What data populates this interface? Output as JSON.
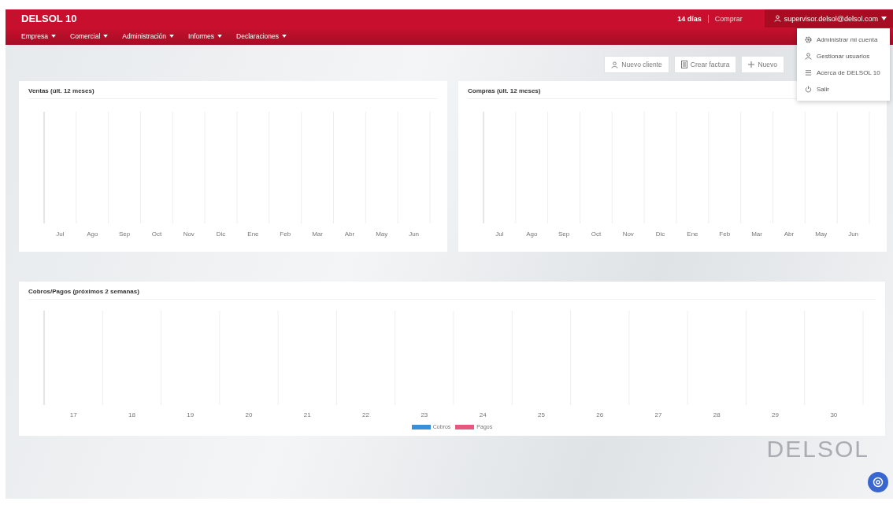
{
  "app": {
    "title": "DELSOL 10",
    "trial": "14 días",
    "trial_link": "Comprar",
    "user": "supervisor.delsol@delsol.com"
  },
  "menu": [
    {
      "label": "Empresa"
    },
    {
      "label": "Comercial"
    },
    {
      "label": "Administración"
    },
    {
      "label": "Informes"
    },
    {
      "label": "Declaraciones"
    }
  ],
  "user_menu": {
    "expanded": true,
    "items": [
      {
        "label": "Administrar mi cuenta",
        "kind": "gear"
      },
      {
        "label": "Gestionar usuarios",
        "kind": "user"
      },
      {
        "label": "Acerca de DELSOL 10",
        "kind": "info"
      },
      {
        "label": "Salir",
        "kind": "power"
      }
    ]
  },
  "toolbar": [
    {
      "label": "Nuevo cliente",
      "kind": "user"
    },
    {
      "label": "Crear factura",
      "kind": "doc"
    },
    {
      "label": "Nuevo",
      "kind": "plus"
    }
  ],
  "charts": [
    {
      "title": "Ventas (últ. 12 meses)",
      "x_labels": [
        "Jul",
        "Ago",
        "Sep",
        "Oct",
        "Nov",
        "Dic",
        "Ene",
        "Feb",
        "Mar",
        "Abr",
        "May",
        "Jun"
      ]
    },
    {
      "title": "Compras (últ. 12 meses)",
      "x_labels": [
        "Jul",
        "Ago",
        "Sep",
        "Oct",
        "Nov",
        "Dic",
        "Ene",
        "Feb",
        "Mar",
        "Abr",
        "May",
        "Jun"
      ]
    },
    {
      "title": "Cobros/Pagos (próximos 2 semanas)",
      "x_labels": [
        "17",
        "18",
        "19",
        "20",
        "21",
        "22",
        "23",
        "24",
        "25",
        "26",
        "27",
        "28",
        "29",
        "30"
      ],
      "legend": [
        {
          "name": "Cobros",
          "color": "#3a8fd9"
        },
        {
          "name": "Pagos",
          "color": "#e8577d"
        }
      ]
    }
  ],
  "brand": "DELSOL"
}
